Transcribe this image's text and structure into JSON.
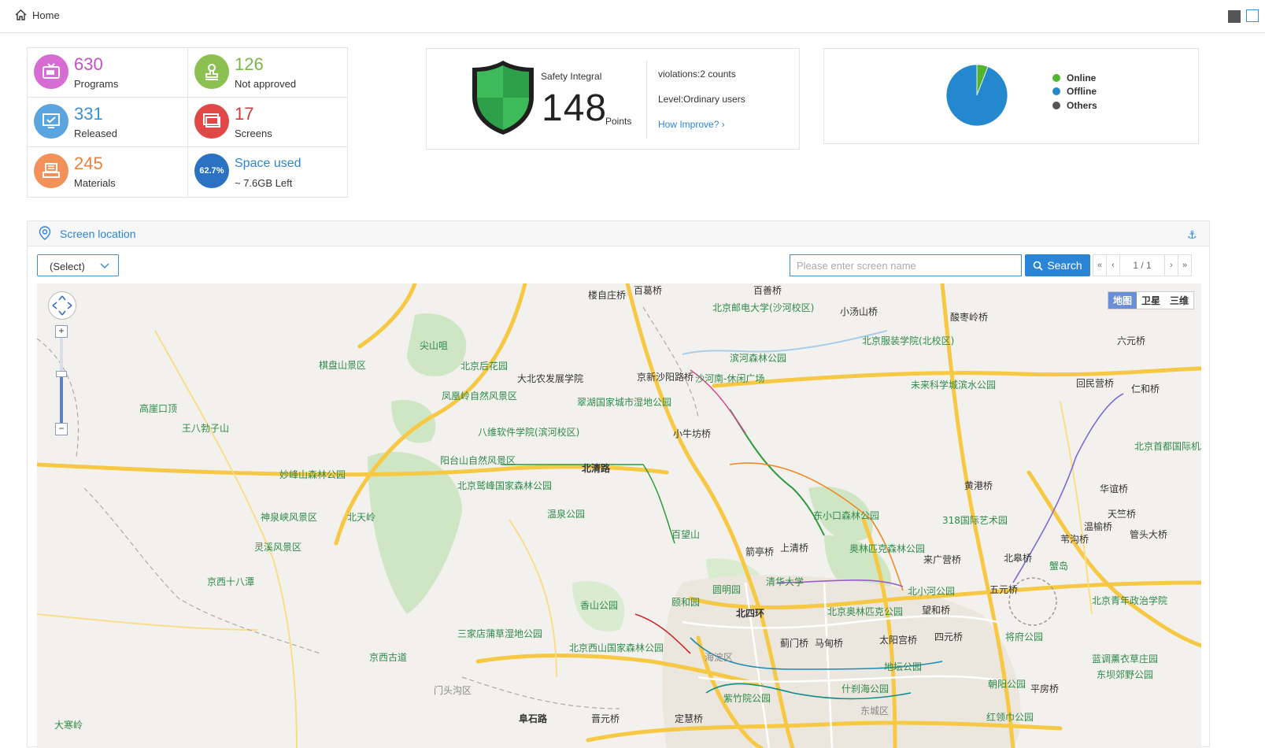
{
  "topbar": {
    "home_label": "Home"
  },
  "stats": [
    {
      "value": "630",
      "label": "Programs",
      "color": "#c650c1",
      "icon": "tv-icon"
    },
    {
      "value": "126",
      "label": "Not approved",
      "color": "#7ab648",
      "icon": "stamp-icon"
    },
    {
      "value": "331",
      "label": "Released",
      "color": "#3b8fd4",
      "icon": "monitor-icon"
    },
    {
      "value": "17",
      "label": "Screens",
      "color": "#d43a3a",
      "icon": "screens-icon"
    },
    {
      "value": "245",
      "label": "Materials",
      "color": "#ec7f3f",
      "icon": "materials-icon"
    },
    {
      "value": "Space used",
      "label": "~ 7.6GB Left",
      "color": "#2b85d6",
      "icon": "storage-gauge",
      "percent_label": "62.7%"
    }
  ],
  "safety": {
    "title": "Safety Integral",
    "score": "148",
    "unit": "Points",
    "violations": "violations:2 counts",
    "level": "Level:Ordinary users",
    "improve_link": "How Improve?"
  },
  "status_pie": {
    "legend": [
      {
        "label": "Online",
        "color": "#52b52f"
      },
      {
        "label": "Offline",
        "color": "#2488cf"
      },
      {
        "label": "Others",
        "color": "#555555"
      }
    ],
    "values": {
      "Online": 1,
      "Offline": 16,
      "Others": 0
    }
  },
  "location_panel": {
    "title": "Screen location",
    "select_value": "(Select)",
    "search_placeholder": "Please enter screen name",
    "search_button": "Search",
    "pager": {
      "first": "«",
      "prev": "‹",
      "page": "1 / 1",
      "next": "›",
      "last": "»"
    },
    "map_types": [
      "地图",
      "卫星",
      "三维"
    ],
    "zoom_in": "+",
    "zoom_out": "−"
  },
  "map_labels": {
    "l1": "楼自庄桥",
    "l2": "百葛桥",
    "l3": "百善桥",
    "l4": "北京邮电大学(沙河校区)",
    "l5": "小汤山桥",
    "l6": "酸枣岭桥",
    "l7": "北京服装学院(北校区)",
    "l8": "六元桥",
    "l9": "尖山咀",
    "l10": "棋盘山景区",
    "l11": "北京后花园",
    "l12": "大北农发展学院",
    "l13": "京新沙阳路桥",
    "l14": "沙河南-休闲广场",
    "l15": "滨河森林公园",
    "l16": "未来科学城滨水公园",
    "l17": "回民营桥",
    "l18": "仁和桥",
    "l19": "凤凰岭自然风景区",
    "l20": "翠湖国家城市湿地公园",
    "l21": "高崖口顶",
    "l22": "王八勃子山",
    "l23": "八维软件学院(滨河校区)",
    "l24": "小牛坊桥",
    "l25": "北京首都国际机场",
    "l26": "阳台山自然风景区",
    "l27": "北清路",
    "l28": "妙峰山森林公园",
    "l29": "北京鹫峰国家森林公园",
    "l30": "黄港桥",
    "l31": "华谊桥",
    "l32": "温泉公园",
    "l33": "东小口森林公园",
    "l34": "神泉峡风景区",
    "l35": "北天岭",
    "l36": "318国际艺术园",
    "l37": "天竺桥",
    "l38": "温榆桥",
    "l39": "管头大桥",
    "l40": "灵溪风景区",
    "l41": "百望山",
    "l42": "箭亭桥",
    "l43": "上清桥",
    "l44": "奥林匹克森林公园",
    "l45": "来广营桥",
    "l46": "北皋桥",
    "l47": "苇沟桥",
    "l48": "京西十八潭",
    "l49": "清华大学",
    "l50": "圆明园",
    "l51": "颐和园",
    "l52": "北小河公园",
    "l53": "五元桥",
    "l54": "蟹岛",
    "l55": "北京青年政治学院",
    "l56": "香山公园",
    "l57": "北四环",
    "l58": "北京奥林匹克公园",
    "l59": "望和桥",
    "l60": "三家店蒲草湿地公园",
    "l61": "北京西山国家森林公园",
    "l62": "海淀区",
    "l63": "蓟门桥",
    "l64": "马甸桥",
    "l65": "太阳宫桥",
    "l66": "四元桥",
    "l67": "将府公园",
    "l68": "蓝调薰衣草庄园",
    "l69": "京西古道",
    "l70": "地坛公园",
    "l71": "朝阳公园",
    "l72": "东坝郊野公园",
    "l73": "门头沟区",
    "l74": "紫竹院公园",
    "l75": "什刹海公园",
    "l76": "平房桥",
    "l77": "阜石路",
    "l78": "晋元桥",
    "l79": "定慧桥",
    "l80": "东城区",
    "l81": "红领巾公园",
    "l82": "大寒岭"
  }
}
